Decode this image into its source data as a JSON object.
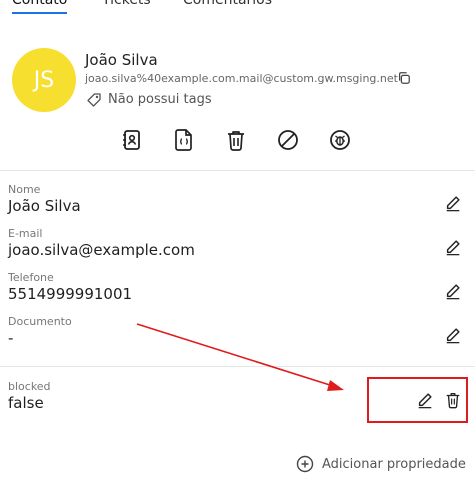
{
  "tabs": [
    {
      "label": "Contato",
      "active": true
    },
    {
      "label": "Tickets",
      "active": false
    },
    {
      "label": "Comentarios",
      "active": false
    }
  ],
  "contact": {
    "initials": "JS",
    "name": "João Silva",
    "email": "joao.silva%40example.com.mail@custom.gw.msging.net",
    "tags_text": "Não possui tags"
  },
  "fields": [
    {
      "label": "Nome",
      "value": "João Silva"
    },
    {
      "label": "E-mail",
      "value": "joao.silva@example.com"
    },
    {
      "label": "Telefone",
      "value": "5514999991001"
    },
    {
      "label": "Documento",
      "value": "-"
    },
    {
      "label": "blocked",
      "value": "false"
    }
  ],
  "add_property_label": "Adicionar propriedade",
  "colors": {
    "avatar": "#f7df2f",
    "highlight": "#e01b1b",
    "accent": "#1a73e8"
  },
  "icons": [
    "copy-icon",
    "tag-icon",
    "contact-card-icon",
    "json-file-icon",
    "trash-icon",
    "block-icon",
    "bug-icon",
    "pencil-icon",
    "plus-circle-icon"
  ]
}
